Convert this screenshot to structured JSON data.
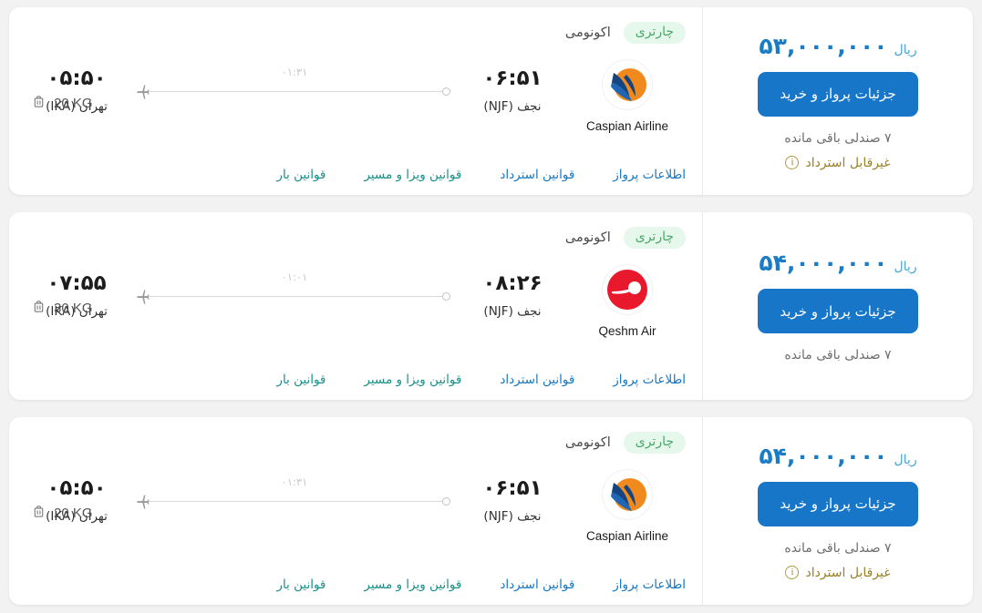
{
  "labels": {
    "currency": "ریال",
    "buy_button": "جزئیات پرواز و خرید",
    "charter_badge": "چارتری",
    "cabin_class": "اکونومی",
    "refund_note": "غیرقابل استرداد",
    "info_icon_glyph": "i"
  },
  "link_labels": {
    "flight_info": "اطلاعات پرواز",
    "refund_rules": "قوانین استرداد",
    "visa_route_rules": "قوانین ویزا و مسیر",
    "baggage_rules": "قوانین بار"
  },
  "colors": {
    "price": "#1a7cc4",
    "buy_button": "#1776c8",
    "charter_badge_bg": "#e6f7ec",
    "charter_badge_text": "#4aa869",
    "link_teal": "#1a8f87",
    "link_blue": "#1777c2",
    "refund_amber": "#9a8128",
    "page_bg": "#f2f2f2"
  },
  "flights": [
    {
      "price_amount": "۵۳,۰۰۰,۰۰۰",
      "seats_left": "۷ صندلی باقی مانده",
      "refundable": false,
      "airline_name": "Caspian Airline",
      "airline_logo": "caspian-logo",
      "baggage": "20 KG",
      "arrival_time": "۰۶:۵۱",
      "arrival_city": "نجف (NJF)",
      "departure_time": "۰۵:۵۰",
      "departure_city": "تهران (IKA)",
      "duration": "۰۱:۳۱"
    },
    {
      "price_amount": "۵۴,۰۰۰,۰۰۰",
      "seats_left": "۷ صندلی باقی مانده",
      "refundable": true,
      "airline_name": "Qeshm Air",
      "airline_logo": "qeshm-logo",
      "baggage": "30 KG",
      "arrival_time": "۰۸:۲۶",
      "arrival_city": "نجف (NJF)",
      "departure_time": "۰۷:۵۵",
      "departure_city": "تهران (IKA)",
      "duration": "۰۱:۰۱"
    },
    {
      "price_amount": "۵۴,۰۰۰,۰۰۰",
      "seats_left": "۷ صندلی باقی مانده",
      "refundable": false,
      "airline_name": "Caspian Airline",
      "airline_logo": "caspian-logo",
      "baggage": "20 KG",
      "arrival_time": "۰۶:۵۱",
      "arrival_city": "نجف (NJF)",
      "departure_time": "۰۵:۵۰",
      "departure_city": "تهران (IKA)",
      "duration": "۰۱:۳۱"
    }
  ]
}
